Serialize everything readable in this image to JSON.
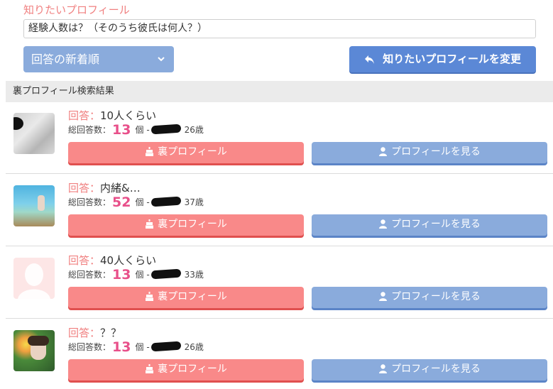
{
  "search": {
    "section_label": "知りたいプロフィール",
    "question": "経験人数は？（そのうち彼氏は何人？）",
    "sort_label": "回答の新着順",
    "change_button": "知りたいプロフィールを変更"
  },
  "results": {
    "header": "裏プロフィール検索結果",
    "answer_prefix": "回答：",
    "count_prefix": "総回答数：",
    "count_unit": "個",
    "separator": "-",
    "ura_button": "裏プロフィール",
    "profile_button": "プロフィールを見る",
    "items": [
      {
        "answer": "10人くらい",
        "count": "13",
        "age": "26歳",
        "avatar_icon": "blurred-photo-avatar"
      },
      {
        "answer": "内緒&…",
        "count": "52",
        "age": "37歳",
        "avatar_icon": "beach-photo-avatar"
      },
      {
        "answer": "40人くらい",
        "count": "13",
        "age": "33歳",
        "avatar_icon": "default-silhouette-avatar"
      },
      {
        "answer": "？？",
        "count": "13",
        "age": "26歳",
        "avatar_icon": "flower-photo-avatar"
      }
    ]
  },
  "colors": {
    "accent_pink": "#f08080",
    "count_pink": "#e8508a",
    "button_red": "#f98989",
    "button_blue": "#8aabdc",
    "change_blue": "#5b88d6"
  }
}
